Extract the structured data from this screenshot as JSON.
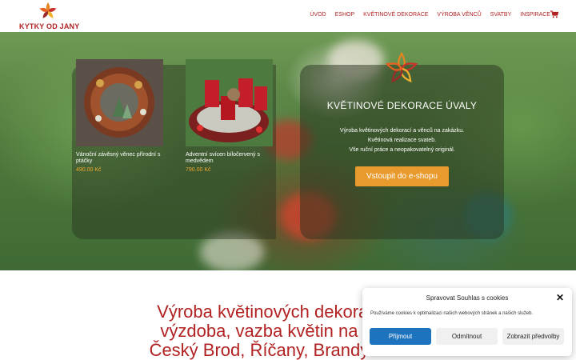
{
  "header": {
    "logo_text": "KYTKY OD JANY",
    "nav": [
      "ÚVOD",
      "ESHOP",
      "KVĚTINOVÉ DEKORACE",
      "VÝROBA VĚNCŮ",
      "SVATBY",
      "INSPIRACE"
    ],
    "cart_icon": "shopping-cart-icon"
  },
  "hero": {
    "products": [
      {
        "name": "Vánoční závěsný věnec přírodní s ptáčky",
        "price": "490.00 Kč"
      },
      {
        "name": "Adventní svícen bíločervený s medvědem",
        "price": "790.00 Kč"
      }
    ],
    "brand_title": "KVĚTINOVÉ  DEKORACE ÚVALY",
    "brand_lines": [
      "Výroba květinových dekorací a věnců na zakázku.",
      "Květinová realizace svateb.",
      "Vše ruční práce a neopakovatelný originál."
    ],
    "cta_label": "Vstoupit do e-shopu"
  },
  "headline": {
    "lines": [
      "Výroba květinových dekorací, sva",
      "výzdoba, vazba květin na objedn",
      "Český Brod, Říčany, Brandýs nad L"
    ]
  },
  "cookie": {
    "title": "Spravovat Souhlas s cookies",
    "text": "Používáme cookies k optimalizaci našich webových stránek a našich služeb.",
    "accept": "Přijmout",
    "deny": "Odmítnout",
    "preferences": "Zobrazit předvolby"
  },
  "colors": {
    "brand_red": "#b22222",
    "accent_orange": "#e99a2c",
    "accept_blue": "#1e73be"
  }
}
